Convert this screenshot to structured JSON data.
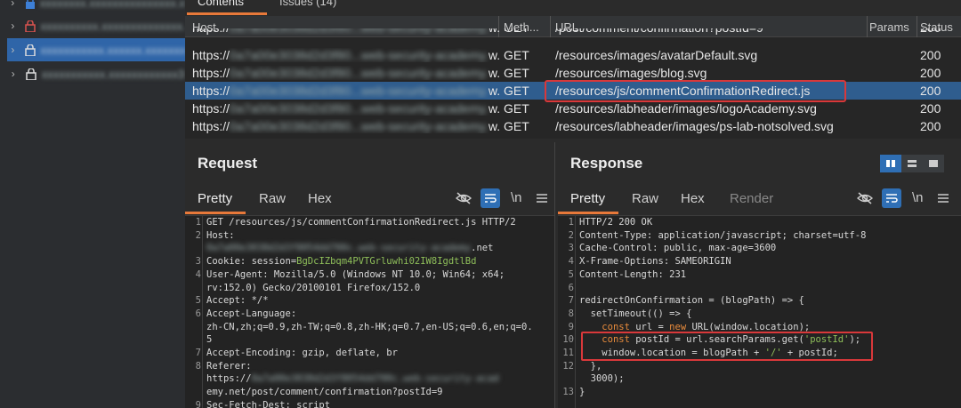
{
  "tabs": {
    "contents": "Contents",
    "issues": "Issues (14)"
  },
  "sites": [
    {
      "name": "xxxxxxxx.xxxxxxxxxxxxxxx.xxxx",
      "secure": "red-lock"
    },
    {
      "name": "xxxxxxxxxx.xxxxxxxxxxxxxx.co",
      "secure": "red-lock"
    },
    {
      "name": "xxxxxxxxxxx.xxxxxx.xxxxxxx30",
      "secure": "lock"
    },
    {
      "name": "xxxxxxxxxxx.xxxxxxxxxxxx30",
      "secure": "lock"
    }
  ],
  "table": {
    "headers": {
      "host": "Host",
      "method": "Meth...",
      "url": "URL",
      "params": "Params",
      "status": "Status"
    },
    "rows": [
      {
        "host": "https://0a7a00e3038d2d3f80...web-security-academy.w...",
        "method": "GET",
        "url": "/post/comment/confirmation?postId=9",
        "status": "200",
        "partial": true
      },
      {
        "host": "https://0a7a00e3038d2d3f80...web-security-academy.w...",
        "method": "GET",
        "url": "/resources/images/avatarDefault.svg",
        "status": "200"
      },
      {
        "host": "https://0a7a00e3038d2d3f80...web-security-academy.w...",
        "method": "GET",
        "url": "/resources/images/blog.svg",
        "status": "200"
      },
      {
        "host": "https://0a7a00e3038d2d3f80...web-security-academy.w...",
        "method": "GET",
        "url": "/resources/js/commentConfirmationRedirect.js",
        "status": "200",
        "selected": true
      },
      {
        "host": "https://0a7a00e3038d2d3f80...web-security-academy.w...",
        "method": "GET",
        "url": "/resources/labheader/images/logoAcademy.svg",
        "status": "200"
      },
      {
        "host": "https://0a7a00e3038d2d3f80...web-security-academy.w...",
        "method": "GET",
        "url": "/resources/labheader/images/ps-lab-notsolved.svg",
        "status": "200"
      }
    ]
  },
  "request": {
    "title": "Request",
    "tabs": [
      "Pretty",
      "Raw",
      "Hex"
    ],
    "line1": "GET /resources/js/commentConfirmationRedirect.js HTTP/2",
    "host_label": "Host:",
    "host_value_blur": "0a7a00e3038d2d3f8054dd700c.web-security-academy",
    "host_suffix": ".net",
    "cookie_label": "Cookie: session=",
    "cookie_value": "BgDcIZbqm4PVTGrluwhi02IW8IgdtlBd",
    "ua1": "User-Agent: Mozilla/5.0 (Windows NT 10.0; Win64; x64;",
    "ua2": "rv:152.0) Gecko/20100101 Firefox/152.0",
    "accept": "Accept: */*",
    "al": "Accept-Language:",
    "al2": "zh-CN,zh;q=0.9,zh-TW;q=0.8,zh-HK;q=0.7,en-US;q=0.6,en;q=0.",
    "al3": "5",
    "ae": "Accept-Encoding: gzip, deflate, br",
    "ref": "Referer:",
    "ref2a": "https://",
    "ref2b": "0a7a00e3038d2d3f8054dd700c.web-security-acad",
    "ref3": "emy.net/post/comment/confirmation?postId=9",
    "sfd": "Sec-Fetch-Dest: script"
  },
  "response": {
    "title": "Response",
    "tabs": [
      "Pretty",
      "Raw",
      "Hex",
      "Render"
    ],
    "l1": "HTTP/2 200 OK",
    "l2": "Content-Type: application/javascript; charset=utf-8",
    "l3": "Cache-Control: public, max-age=3600",
    "l4": "X-Frame-Options: SAMEORIGIN",
    "l5": "Content-Length: 231",
    "l7": "redirectOnConfirmation = (blogPath) => {",
    "l8": "  setTimeout(() => {",
    "l9a": "    ",
    "l9kw": "const",
    "l9b": " url = ",
    "l9kw2": "new",
    "l9c": " URL(window.location);",
    "l10a": "    ",
    "l10kw": "const",
    "l10b": " postId = url.searchParams.get(",
    "l10str": "'postId'",
    "l10c": ");",
    "l11a": "    window.location = blogPath + ",
    "l11str": "'/'",
    "l11c": " + postId;",
    "l12": "  },",
    "l13": "  3000);",
    "l14": "}"
  },
  "icons": {
    "eye_off": "eye-off-icon",
    "wrap": "wrap-icon",
    "newline": "\\n",
    "menu": "menu-icon"
  },
  "colors": {
    "accent": "#e8793a",
    "selection": "#2f5d8e",
    "highlight": "#d9383a"
  }
}
